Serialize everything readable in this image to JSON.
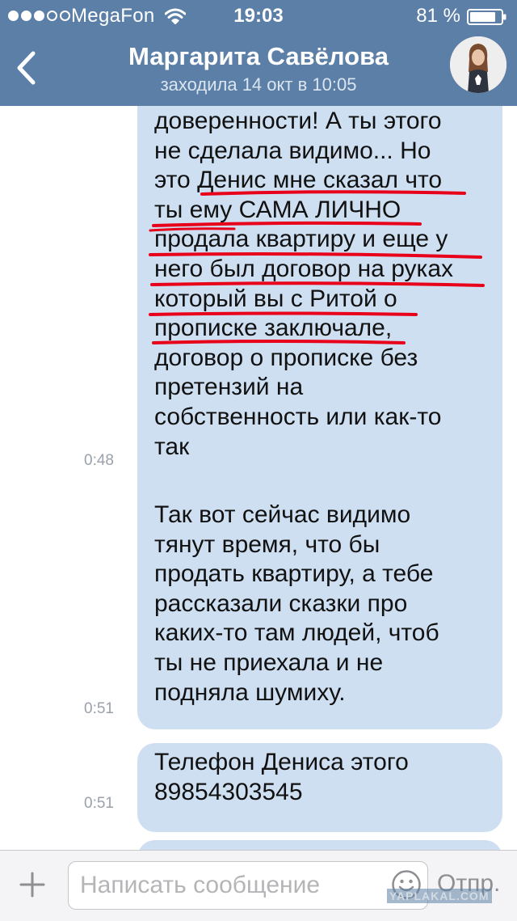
{
  "status_bar": {
    "carrier": "MegaFon",
    "time": "19:03",
    "battery": "81 %"
  },
  "header": {
    "contact_name": "Маргарита Савёлова",
    "last_seen": "заходила 14 окт в 10:05"
  },
  "messages": [
    {
      "lines": [
        "доверенности! А ты этого",
        "не сделала видимо... Но",
        "это Денис мне сказал что",
        "ты ему САМА ЛИЧНО",
        "продала квартиру и еще у",
        "него был договор на руках",
        "который вы с Ритой о",
        "прописке заключале,",
        "договор о прописке без",
        "претензий на",
        "собственность или как-то",
        "так"
      ],
      "time": "0:48"
    },
    {
      "lines": [
        "Так вот сейчас видимо",
        "тянут время, что бы",
        "продать квартиру, а тебе",
        "рассказали сказки про",
        "каких-то там людей, чтоб",
        "ты не приехала и не",
        "подняла шумиху."
      ],
      "time": "0:51"
    },
    {
      "lines": [
        "Телефон Дениса этого",
        "89854303545"
      ],
      "time": "0:51"
    }
  ],
  "composer": {
    "placeholder": "Написать сообщение",
    "send_label": "Отпр."
  },
  "watermark": "YAPLAKAL.COM",
  "colors": {
    "header_bg": "#5b7fa6",
    "bubble_bg": "#cfdff2",
    "underline": "#e8001b"
  }
}
